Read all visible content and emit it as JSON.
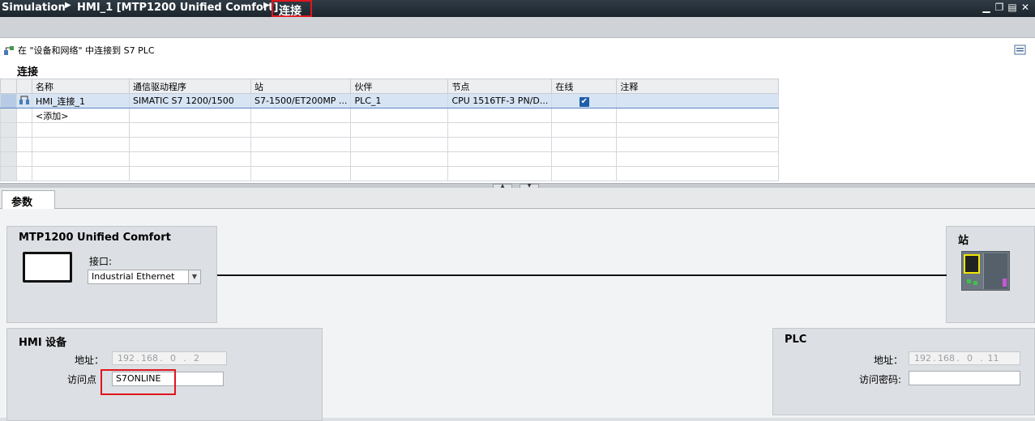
{
  "titlebar": {
    "crumb1": "Simulation",
    "crumb2": "HMI_1 [MTP1200 Unified Comfort]",
    "current": "连接",
    "controls": [
      "minimize-icon",
      "restore-icon",
      "tile-icon",
      "close-icon"
    ]
  },
  "info": {
    "text": "在 \"设备和网络\" 中连接到 S7 PLC"
  },
  "section": {
    "title": "连接"
  },
  "table": {
    "headers": [
      "名称",
      "通信驱动程序",
      "站",
      "伙伴",
      "节点",
      "在线",
      "注释"
    ],
    "rows": [
      {
        "name": "HMI_连接_1",
        "driver": "SIMATIC S7 1200/1500",
        "station": "S7-1500/ET200MP ...",
        "partner": "PLC_1",
        "node": "CPU 1516TF-3 PN/D...",
        "online": "✔",
        "comment": ""
      }
    ],
    "add_label": "<添加>"
  },
  "tabs": {
    "params": "参数"
  },
  "hmi_panel": {
    "device_title": "MTP1200 Unified Comfort",
    "interface_label": "接口:",
    "interface_value": "Industrial Ethernet"
  },
  "station_panel": {
    "title": "站"
  },
  "hmi_device": {
    "title": "HMI 设备",
    "address_label": "地址：",
    "ip": [
      "192",
      "168",
      "0",
      "2"
    ],
    "access_point_label": "访问点",
    "access_point_value": "S7ONLINE"
  },
  "plc": {
    "title": "PLC",
    "address_label": "地址：",
    "ip": [
      "192",
      "168",
      "0",
      "11"
    ],
    "password_label": "访问密码:",
    "password_value": ""
  },
  "colors": {
    "accent_red": "#e0161e",
    "selection": "#d7e4f4",
    "titlebar": "#1c252d"
  }
}
